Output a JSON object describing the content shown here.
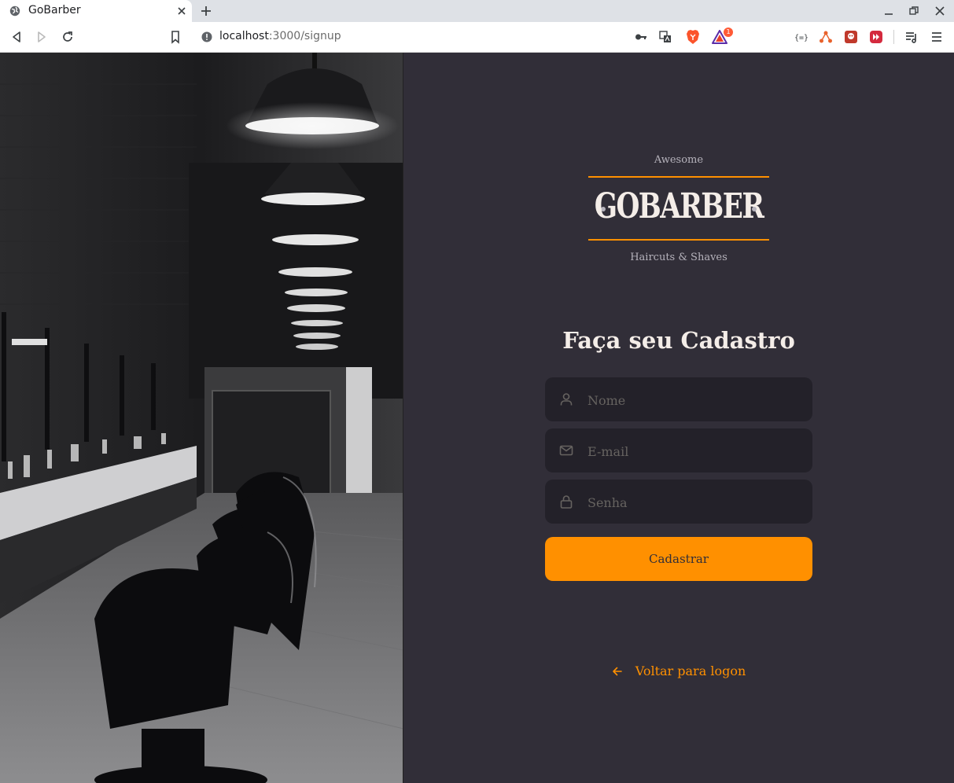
{
  "browser": {
    "tab_title": "GoBarber",
    "url_host": "localhost",
    "url_path": ":3000/signup",
    "extension_badge": "1"
  },
  "logo": {
    "top_text": "Awesome",
    "wordmark": "GOBARBER",
    "bottom_text": "Haircuts & Shaves",
    "accent_color": "#ff9000"
  },
  "form": {
    "title": "Faça seu Cadastro",
    "name_placeholder": "Nome",
    "email_placeholder": "E-mail",
    "password_placeholder": "Senha",
    "submit_label": "Cadastrar"
  },
  "back_link": {
    "label": "Voltar para logon",
    "icon": "arrow-left-icon"
  },
  "colors": {
    "background": "#312e38",
    "input_background": "#232129",
    "primary": "#ff9000",
    "text": "#f4ede8",
    "placeholder": "#666360"
  }
}
